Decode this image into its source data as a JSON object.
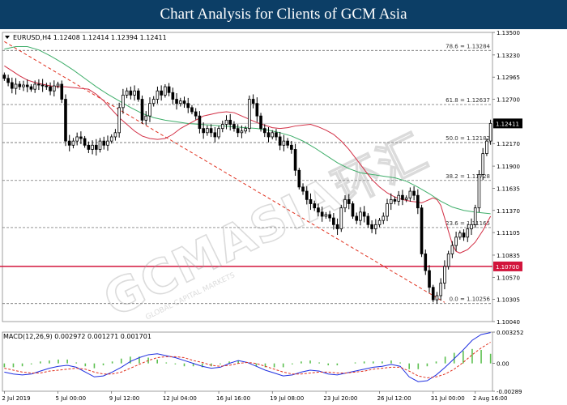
{
  "header": {
    "title": "Chart Analysis for Clients of GCM Asia"
  },
  "colors": {
    "title_bg": "#0c3e66",
    "candle": "#000000",
    "ma_fast": "#d22e44",
    "ma_slow": "#3fae6a",
    "support_line": "#d2153c",
    "trend_line": "#e0301e",
    "macd_line": "#1f2fe0",
    "signal_line": "#e0301e",
    "hist": "#5cc050"
  },
  "chart_data": [
    {
      "type": "candlestick",
      "symbol_info": "EURUSD,H4  1.12408 1.12414 1.12394 1.12411",
      "ylim": [
        1.1004,
        1.135
      ],
      "y_ticks": [
        "1.13500",
        "1.13230",
        "1.12965",
        "1.12700",
        "1.12435",
        "1.12170",
        "1.11900",
        "1.11635",
        "1.11370",
        "1.11105",
        "1.10835",
        "1.10570",
        "1.10305",
        "1.10040"
      ],
      "x_ticks": [
        "2 Jul 2019",
        "5 Jul 00:00",
        "9 Jul 12:00",
        "12 Jul 04:00",
        "16 Jul 16:00",
        "19 Jul 08:00",
        "23 Jul 20:00",
        "26 Jul 12:00",
        "31 Jul 00:00",
        "2 Aug 16:00"
      ],
      "fibonacci_levels": [
        {
          "label": "78.6 = 1.13284",
          "value": 1.13284
        },
        {
          "label": "61.8 = 1.12637",
          "value": 1.12637
        },
        {
          "label": "50.0 = 1.12182",
          "value": 1.12182
        },
        {
          "label": "38.2 = 1.11728",
          "value": 1.11728
        },
        {
          "label": "23.6 = 1.11165",
          "value": 1.11165
        },
        {
          "label": "0.0 = 1.10256",
          "value": 1.10256
        }
      ],
      "support_level": {
        "label": "1.10700",
        "value": 1.107
      },
      "current_price": {
        "label": "1.12411",
        "value": 1.12411
      },
      "trend_line": {
        "from": [
          0,
          1.1339
        ],
        "to": [
          115,
          1.1027
        ]
      },
      "closes": [
        1.1295,
        1.129,
        1.1283,
        1.1288,
        1.1285,
        1.1287,
        1.1285,
        1.1282,
        1.1288,
        1.1287,
        1.1286,
        1.1285,
        1.128,
        1.1286,
        1.1288,
        1.127,
        1.122,
        1.1215,
        1.122,
        1.1225,
        1.1223,
        1.1215,
        1.121,
        1.1215,
        1.121,
        1.122,
        1.1215,
        1.122,
        1.1225,
        1.123,
        1.126,
        1.1275,
        1.128,
        1.1275,
        1.128,
        1.127,
        1.1245,
        1.125,
        1.1265,
        1.127,
        1.128,
        1.1275,
        1.1285,
        1.1278,
        1.127,
        1.1265,
        1.1268,
        1.1265,
        1.126,
        1.1255,
        1.125,
        1.1235,
        1.123,
        1.1235,
        1.123,
        1.1225,
        1.1235,
        1.124,
        1.1245,
        1.124,
        1.1235,
        1.123,
        1.1232,
        1.1235,
        1.127,
        1.1265,
        1.125,
        1.1235,
        1.123,
        1.1225,
        1.123,
        1.1225,
        1.1215,
        1.122,
        1.1215,
        1.121,
        1.1185,
        1.1165,
        1.116,
        1.115,
        1.1145,
        1.114,
        1.1135,
        1.113,
        1.1132,
        1.1128,
        1.112,
        1.1115,
        1.114,
        1.115,
        1.1145,
        1.113,
        1.1125,
        1.1135,
        1.113,
        1.112,
        1.1115,
        1.112,
        1.1125,
        1.113,
        1.1145,
        1.115,
        1.1148,
        1.1155,
        1.115,
        1.1152,
        1.116,
        1.1155,
        1.114,
        1.1085,
        1.1065,
        1.1045,
        1.103,
        1.1035,
        1.105,
        1.107,
        1.1085,
        1.1095,
        1.1105,
        1.111,
        1.1105,
        1.1115,
        1.112,
        1.114,
        1.118,
        1.1205,
        1.122,
        1.12411
      ],
      "ma_fast": [
        1.131,
        1.1304,
        1.1298,
        1.1293,
        1.129,
        1.1288,
        1.1286,
        1.1285,
        1.1285,
        1.1284,
        1.1283,
        1.1282,
        1.1276,
        1.1268,
        1.1258,
        1.1248,
        1.124,
        1.1232,
        1.1226,
        1.1223,
        1.1222,
        1.1223,
        1.1228,
        1.1235,
        1.124,
        1.1245,
        1.125,
        1.1252,
        1.1254,
        1.1255,
        1.1254,
        1.125,
        1.1246,
        1.1242,
        1.1239,
        1.1236,
        1.1235,
        1.1236,
        1.1238,
        1.1239,
        1.124,
        1.1237,
        1.1233,
        1.1228,
        1.122,
        1.121,
        1.1198,
        1.1186,
        1.1174,
        1.1165,
        1.1158,
        1.1153,
        1.115,
        1.1148,
        1.1147,
        1.1146,
        1.1148,
        1.115,
        1.1152,
        1.115,
        1.1143,
        1.1128,
        1.1112,
        1.1097,
        1.1088,
        1.1086,
        1.109,
        1.1099,
        1.1113,
        1.113
      ],
      "ma_fast_x": [
        0,
        2,
        4,
        6,
        8,
        10,
        12,
        14,
        16,
        18,
        20,
        22,
        24,
        26,
        28,
        30,
        32,
        34,
        36,
        38,
        40,
        42,
        44,
        46,
        48,
        50,
        52,
        54,
        56,
        58,
        60,
        62,
        64,
        66,
        68,
        70,
        72,
        74,
        76,
        78,
        80,
        82,
        84,
        86,
        88,
        90,
        92,
        94,
        96,
        98,
        100,
        102,
        104,
        106,
        108,
        109,
        110,
        111,
        112,
        113,
        114,
        115,
        116,
        117,
        118,
        119,
        121,
        123,
        125,
        127
      ],
      "ma_slow": [
        1.133,
        1.1333,
        1.1333,
        1.1329,
        1.1322,
        1.1314,
        1.1305,
        1.1295,
        1.1285,
        1.1276,
        1.1268,
        1.126,
        1.1253,
        1.1248,
        1.1245,
        1.1243,
        1.1241,
        1.124,
        1.1239,
        1.1238,
        1.1237,
        1.1236,
        1.1235,
        1.1233,
        1.123,
        1.1226,
        1.122,
        1.1212,
        1.1203,
        1.1194,
        1.1187,
        1.1182,
        1.118,
        1.1178,
        1.1176,
        1.1172,
        1.1165,
        1.1157,
        1.1148,
        1.1141,
        1.1137,
        1.1135,
        1.1133
      ],
      "ma_slow_x": [
        0,
        3,
        6,
        9,
        12,
        15,
        18,
        21,
        24,
        27,
        30,
        33,
        36,
        39,
        42,
        45,
        48,
        51,
        54,
        57,
        60,
        63,
        66,
        69,
        72,
        75,
        78,
        81,
        84,
        87,
        90,
        93,
        96,
        99,
        102,
        105,
        108,
        111,
        114,
        117,
        120,
        123,
        127
      ]
    },
    {
      "type": "macd",
      "label": "MACD(12,26,9) 0.002972 0.001271 0.001701",
      "ylim": [
        -0.00289,
        0.003252
      ],
      "y_ticks": [
        "0.003252",
        "0.00",
        "-0.00289"
      ],
      "macd": [
        -0.0009,
        -0.0011,
        -0.0012,
        -0.0011,
        -0.0008,
        -0.0005,
        -0.0003,
        -0.0002,
        -0.0004,
        -0.0009,
        -0.0014,
        -0.0013,
        -0.0009,
        -0.0004,
        0.0002,
        0.0006,
        0.0009,
        0.001,
        0.0008,
        0.0006,
        0.0003,
        0.0,
        -0.0003,
        -0.0005,
        -0.0004,
        0.0,
        0.0003,
        0.0001,
        -0.0003,
        -0.0007,
        -0.001,
        -0.0013,
        -0.0012,
        -0.0009,
        -0.0007,
        -0.0008,
        -0.0011,
        -0.0012,
        -0.001,
        -0.0008,
        -0.0006,
        -0.0004,
        -0.0003,
        -0.0001,
        -0.0003,
        -0.0014,
        -0.0019,
        -0.0018,
        -0.0012,
        -0.0004,
        0.0005,
        0.0014,
        0.0024,
        0.003,
        0.0032
      ],
      "signal": [
        -0.0005,
        -0.0007,
        -0.0009,
        -0.001,
        -0.001,
        -0.0008,
        -0.0007,
        -0.0006,
        -0.0005,
        -0.0006,
        -0.0009,
        -0.0011,
        -0.0011,
        -0.0009,
        -0.0005,
        -0.0001,
        0.0003,
        0.0006,
        0.0007,
        0.0007,
        0.0006,
        0.0003,
        0.0001,
        -0.0002,
        -0.0003,
        -0.0002,
        0.0,
        0.0001,
        0.0,
        -0.0003,
        -0.0006,
        -0.0009,
        -0.0011,
        -0.0011,
        -0.001,
        -0.0009,
        -0.0009,
        -0.001,
        -0.001,
        -0.0009,
        -0.0008,
        -0.0006,
        -0.0005,
        -0.0004,
        -0.0004,
        -0.0008,
        -0.0013,
        -0.0015,
        -0.0014,
        -0.0011,
        -0.0006,
        0.0001,
        0.0009,
        0.0016,
        0.0022
      ],
      "x": [
        0,
        2.35,
        4.7,
        7.05,
        9.4,
        11.75,
        14.1,
        16.45,
        18.8,
        21.15,
        23.5,
        25.85,
        28.2,
        30.55,
        32.9,
        35.25,
        37.6,
        39.95,
        42.3,
        44.65,
        47,
        49.35,
        51.7,
        54.05,
        56.4,
        58.75,
        61.1,
        63.45,
        65.8,
        68.15,
        70.5,
        72.85,
        75.2,
        77.55,
        79.9,
        82.25,
        84.6,
        86.95,
        89.3,
        91.65,
        94,
        96.35,
        98.7,
        101.05,
        103.4,
        105.75,
        108.1,
        110.45,
        112.8,
        115.15,
        117.5,
        119.85,
        122.2,
        124.55,
        127
      ]
    }
  ]
}
